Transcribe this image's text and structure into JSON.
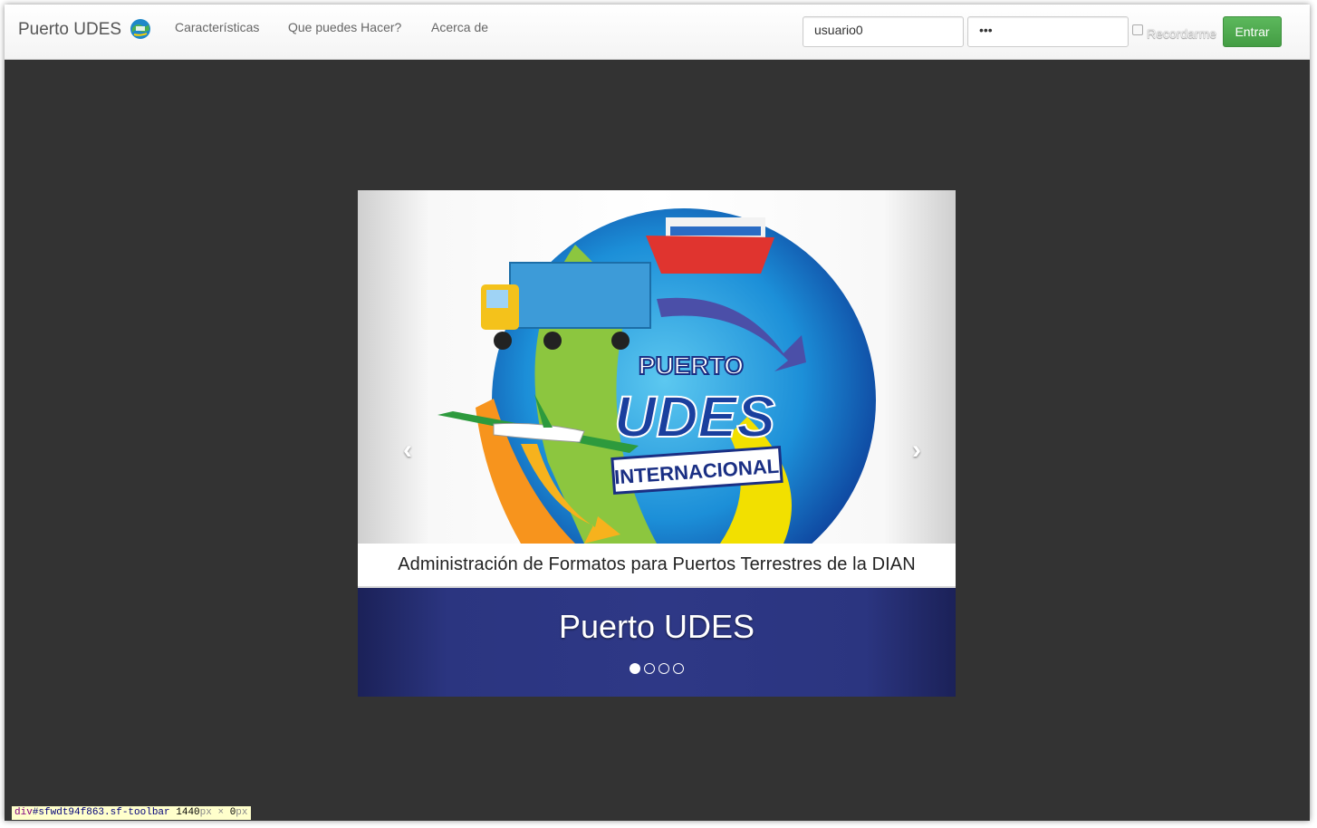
{
  "navbar": {
    "brand": "Puerto UDES",
    "links": [
      "Características",
      "Que puedes Hacer?",
      "Acerca de"
    ],
    "username_value": "usuario0",
    "password_value": "•••",
    "remember_label": "Recordarme",
    "login_label": "Entrar"
  },
  "carousel": {
    "logo_line1": "PUERTO",
    "logo_line2": "UDES",
    "logo_line3": "INTERNACIONAL",
    "subtitle": "Administración de Formatos para Puertos Terrestres de la DIAN",
    "caption": "Puerto UDES",
    "indicator_count": 4,
    "active_index": 0,
    "prev_icon": "chevron-left-icon",
    "next_icon": "chevron-right-icon"
  },
  "debug_tag": {
    "element": "div",
    "selector": "#sfwdt94f863.sf-toolbar",
    "width": "1440",
    "height": "0",
    "unit": "px",
    "times": "×"
  },
  "colors": {
    "page_background": "#333333",
    "login_button": "#5cb85c",
    "caption_band": "#2e3886"
  }
}
